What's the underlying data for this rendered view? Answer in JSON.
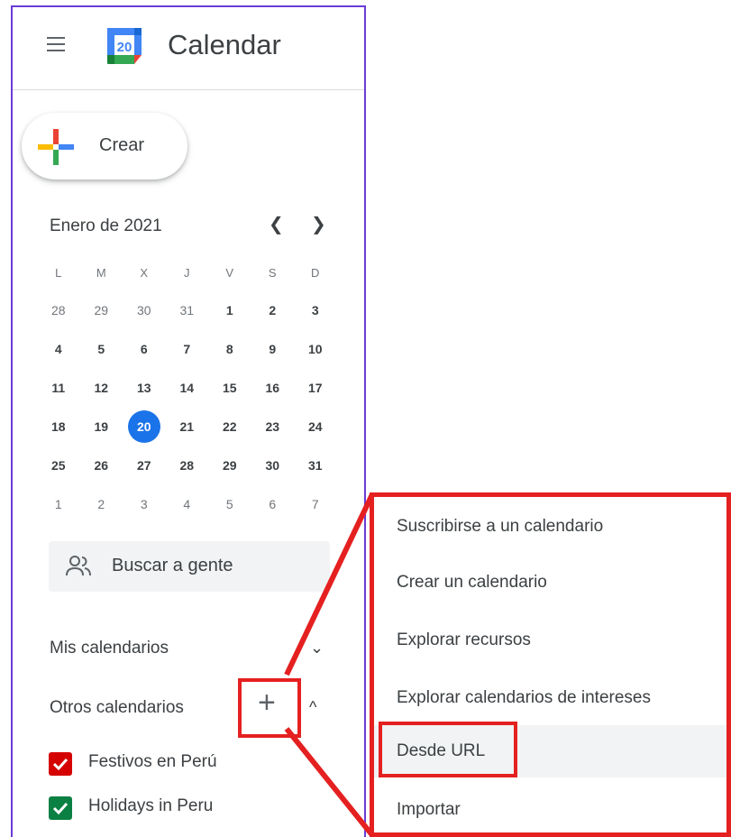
{
  "header": {
    "app_title": "Calendar",
    "logo_day": "20",
    "menu_icon": "hamburger-menu-icon"
  },
  "create": {
    "label": "Crear"
  },
  "mini_calendar": {
    "month_label": "Enero de 2021",
    "prev_icon": "chevron-left-icon",
    "next_icon": "chevron-right-icon",
    "weekdays": [
      "L",
      "M",
      "X",
      "J",
      "V",
      "S",
      "D"
    ],
    "weeks": [
      [
        "28",
        "29",
        "30",
        "31",
        "1",
        "2",
        "3"
      ],
      [
        "4",
        "5",
        "6",
        "7",
        "8",
        "9",
        "10"
      ],
      [
        "11",
        "12",
        "13",
        "14",
        "15",
        "16",
        "17"
      ],
      [
        "18",
        "19",
        "20",
        "21",
        "22",
        "23",
        "24"
      ],
      [
        "25",
        "26",
        "27",
        "28",
        "29",
        "30",
        "31"
      ],
      [
        "1",
        "2",
        "3",
        "4",
        "5",
        "6",
        "7"
      ]
    ],
    "today": "20",
    "today_color": "#1a73e8"
  },
  "search_people": {
    "label": "Buscar a gente",
    "icon": "people-icon"
  },
  "my_calendars": {
    "title": "Mis calendarios",
    "chevron": "⌄"
  },
  "other_calendars": {
    "title": "Otros calendarios",
    "add_label": "+",
    "chevron": "^",
    "items": [
      {
        "name": "Festivos en Perú",
        "color": "#d50000"
      },
      {
        "name": "Holidays in Peru",
        "color": "#0b8043"
      }
    ]
  },
  "add_menu": {
    "items": [
      {
        "label": "Suscribirse a un calendario"
      },
      {
        "label": "Crear un calendario"
      },
      {
        "label": "Explorar recursos"
      },
      {
        "label": "Explorar calendarios de intereses"
      },
      {
        "label": "Desde URL"
      },
      {
        "label": "Importar"
      }
    ],
    "active_index": 4
  },
  "annotation": {
    "color": "#e52020"
  }
}
